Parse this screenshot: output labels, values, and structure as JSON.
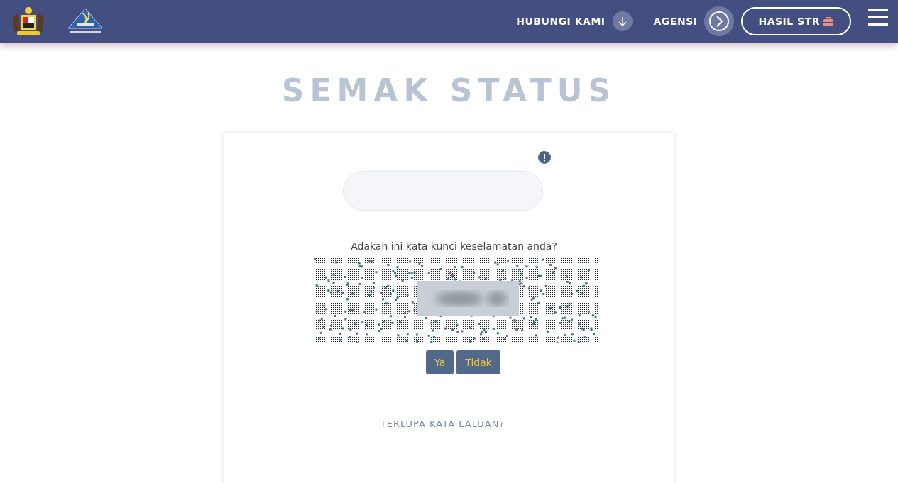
{
  "header": {
    "nav": [
      {
        "label": "HUBUNGI KAMI",
        "kind": "down"
      },
      {
        "label": "AGENSI",
        "kind": "next"
      }
    ],
    "cta": {
      "label": "HASIL STR"
    }
  },
  "page_title": "SEMAK STATUS",
  "form": {
    "question": "Adakah ini kata kunci keselamatan anda?",
    "buttons": [
      {
        "label": "Ya"
      },
      {
        "label": "Tidak"
      }
    ],
    "forgot_link": "TERLUPA KATA LALUAN?"
  }
}
